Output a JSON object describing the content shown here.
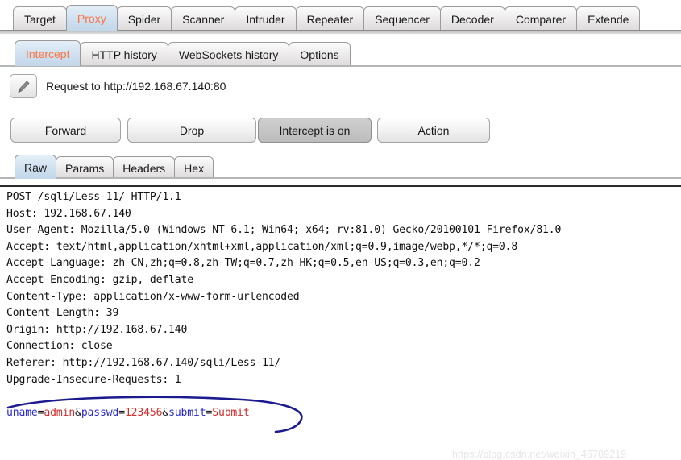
{
  "app": {
    "name": "Burp Suite Proxy",
    "accent_selected_tab_text": "#fc7341",
    "accent_selected_tab_bg": "#c2d7ea"
  },
  "main_tabs": {
    "selected": "Proxy",
    "items": [
      {
        "label": "Target"
      },
      {
        "label": "Proxy"
      },
      {
        "label": "Spider"
      },
      {
        "label": "Scanner"
      },
      {
        "label": "Intruder"
      },
      {
        "label": "Repeater"
      },
      {
        "label": "Sequencer"
      },
      {
        "label": "Decoder"
      },
      {
        "label": "Comparer"
      },
      {
        "label": "Extende"
      }
    ]
  },
  "sub_tabs": {
    "selected": "Intercept",
    "items": [
      {
        "label": "Intercept"
      },
      {
        "label": "HTTP history"
      },
      {
        "label": "WebSockets history"
      },
      {
        "label": "Options"
      }
    ]
  },
  "request_strip": {
    "edit_icon": "pencil-icon",
    "text": "Request to http://192.168.67.140:80"
  },
  "action_buttons": {
    "forward": "Forward",
    "drop": "Drop",
    "intercept_toggle": "Intercept is on",
    "action": "Action"
  },
  "view_tabs": {
    "selected": "Raw",
    "items": [
      {
        "label": "Raw"
      },
      {
        "label": "Params"
      },
      {
        "label": "Headers"
      },
      {
        "label": "Hex"
      }
    ]
  },
  "request": {
    "headers_text": "POST /sqli/Less-11/ HTTP/1.1\nHost: 192.168.67.140\nUser-Agent: Mozilla/5.0 (Windows NT 6.1; Win64; x64; rv:81.0) Gecko/20100101 Firefox/81.0\nAccept: text/html,application/xhtml+xml,application/xml;q=0.9,image/webp,*/*;q=0.8\nAccept-Language: zh-CN,zh;q=0.8,zh-TW;q=0.7,zh-HK;q=0.5,en-US;q=0.3,en;q=0.2\nAccept-Encoding: gzip, deflate\nContent-Type: application/x-www-form-urlencoded\nContent-Length: 39\nOrigin: http://192.168.67.140\nConnection: close\nReferer: http://192.168.67.140/sqli/Less-11/\nUpgrade-Insecure-Requests: 1",
    "body_params": [
      {
        "key": "uname",
        "eq": "=",
        "value": "admin",
        "amp": "&"
      },
      {
        "key": "passwd",
        "eq": "=",
        "value": "123456",
        "amp": "&"
      },
      {
        "key": "submit",
        "eq": "=",
        "value": "Submit",
        "amp": ""
      }
    ],
    "body_raw": "uname=admin&passwd=123456&submit=Submit"
  },
  "annotation": {
    "shape": "hand-drawn-ellipse",
    "color": "#1b1b8f"
  },
  "watermark": {
    "text": "https://blog.csdn.net/weixin_46709219"
  }
}
